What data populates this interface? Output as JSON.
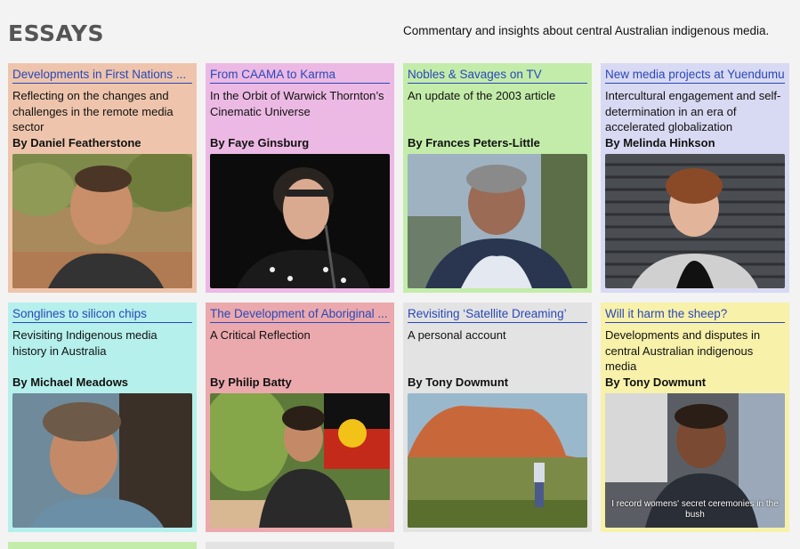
{
  "header": {
    "title": "ESSAYS",
    "tagline": "Commentary and insights about central Australian indigenous media."
  },
  "cards": [
    {
      "title": "Developments in First Nations ...",
      "desc": "Reflecting on the changes and challenges in the remote media sector",
      "author": "By Daniel Featherstone",
      "bg": "#eec5ac"
    },
    {
      "title": "From CAAMA to Karma",
      "desc": "In the Orbit of Warwick Thornton’s Cinematic Universe",
      "author": "By Faye Ginsburg",
      "bg": "#ecb9e4"
    },
    {
      "title": "Nobles & Savages on TV",
      "desc": "An update of the 2003 article",
      "author": "By Frances Peters-Little",
      "bg": "#c3ecaa"
    },
    {
      "title": "New media projects at Yuendumu",
      "desc": "Intercultural engagement and self-determination in an era of accelerated globalization",
      "author": "By Melinda Hinkson",
      "bg": "#d8d9f2"
    },
    {
      "title": "Songlines to silicon chips",
      "desc": "Revisiting Indigenous media history in Australia",
      "author": "By Michael Meadows",
      "bg": "#b5f0ec"
    },
    {
      "title": "The Development of Aboriginal ...",
      "desc": "A Critical Reflection",
      "author": "By Philip Batty",
      "bg": "#eba9ad"
    },
    {
      "title": "Revisiting ‘Satellite Dreaming’",
      "desc": "A personal account",
      "author": "By Tony Dowmunt",
      "bg": "#e3e3e3"
    },
    {
      "title": "Will it harm the sheep?",
      "desc": "Developments and disputes in central Australian indigenous media",
      "author": "By Tony Dowmunt",
      "bg": "#f7f1aa",
      "caption": "I record womens' secret ceremonies in the bush"
    }
  ]
}
